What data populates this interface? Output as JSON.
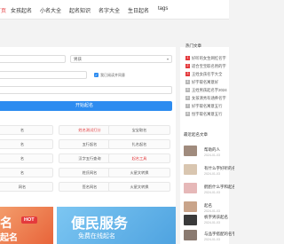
{
  "nav": {
    "items": [
      {
        "label": "首页",
        "active": true
      },
      {
        "label": "女孩起名",
        "active": false
      },
      {
        "label": "小名大全",
        "active": false
      },
      {
        "label": "起名知识",
        "active": false
      },
      {
        "label": "名字大全",
        "active": false
      },
      {
        "label": "生日起名",
        "active": false
      },
      {
        "label": "tags",
        "active": false
      }
    ]
  },
  "form": {
    "gender_value": "男孩",
    "checkbox_label": "我已阅读并同意",
    "submit_label": "开始起名"
  },
  "tools": [
    {
      "label": "名",
      "red": false
    },
    {
      "label": "姓名测试打分",
      "red": true
    },
    {
      "label": "宝宝取名",
      "red": false
    },
    {
      "label": "名",
      "red": false
    },
    {
      "label": "五行起名",
      "red": false
    },
    {
      "label": "扎名起名",
      "red": false
    },
    {
      "label": "名",
      "red": false
    },
    {
      "label": "汉字五行查询",
      "red": false
    },
    {
      "label": "起名工具",
      "red": true
    },
    {
      "label": "名",
      "red": false
    },
    {
      "label": "姓氏网名",
      "red": false
    },
    {
      "label": "火星文转换",
      "red": false
    },
    {
      "label": "网名",
      "red": false
    },
    {
      "label": "签名网名",
      "red": false
    },
    {
      "label": "火星文转换",
      "red": false
    }
  ],
  "banners": [
    {
      "text": "名",
      "badge": "HOT",
      "sub": "起名"
    },
    {
      "text": "便民服务",
      "sub": "免费在线起名"
    }
  ],
  "colors": {
    "accent": "#2d8cf0",
    "hot": "#e4393c"
  },
  "aside": {
    "hot_title": "热门文章",
    "hot_items": [
      {
        "num": "1",
        "text": "好听的女生网红名字"
      },
      {
        "num": "2",
        "text": "适合宝宝取名用的字"
      },
      {
        "num": "3",
        "text": "王姓女孩名字大全"
      },
      {
        "num": "4",
        "text": "好字取名寓意好"
      },
      {
        "num": "5",
        "text": "王姓男孩起名字2024"
      },
      {
        "num": "6",
        "text": "女孩清秀有涵养名字"
      },
      {
        "num": "7",
        "text": "好字取名寓意五行"
      },
      {
        "num": "8",
        "text": "恒字取名寓意五行"
      }
    ],
    "latest_title": "最近起名文章",
    "articles": [
      {
        "title": "帮助的人",
        "date": "2024-01-03"
      },
      {
        "title": "有什么字好听的名字",
        "date": "2024-01-03"
      },
      {
        "title": "鹤酌什么字和起名",
        "date": "2024-01-03"
      },
      {
        "title": "起名",
        "date": "2024-01-03"
      },
      {
        "title": "帆字男孩起名",
        "date": "2024-01-03"
      },
      {
        "title": "与品字搭配的名字",
        "date": "2024-01-03"
      }
    ]
  }
}
